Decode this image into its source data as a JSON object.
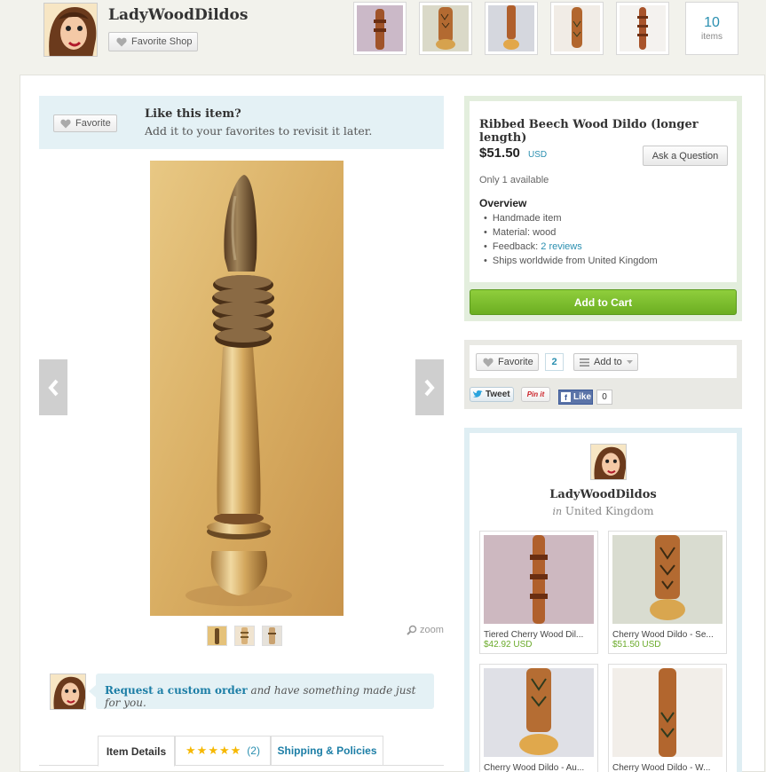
{
  "shop": {
    "name": "LadyWoodDildos",
    "favorite_shop_label": "Favorite Shop",
    "item_count": "10",
    "item_count_label": "items",
    "location_prefix": "in",
    "location": "United Kingdom"
  },
  "like_box": {
    "favorite_label": "Favorite",
    "title": "Like this item?",
    "subtitle": "Add it to your favorites to revisit it later."
  },
  "gallery": {
    "zoom_label": "zoom"
  },
  "custom_order": {
    "link": "Request a custom order",
    "rest": " and have something made just for you."
  },
  "tabs": {
    "details": "Item Details",
    "stars": "★★★★★",
    "review_count": "(2)",
    "shipping": "Shipping & Policies"
  },
  "item": {
    "title": "Ribbed Beech Wood Dildo (longer length)",
    "price": "$51.50",
    "currency": "USD",
    "ask_label": "Ask a Question",
    "availability": "Only 1 available",
    "overview_heading": "Overview",
    "overview": {
      "handmade": "Handmade item",
      "material": "Material: wood",
      "feedback_prefix": "Feedback: ",
      "feedback_link": "2 reviews",
      "ships": "Ships worldwide from United Kingdom"
    },
    "add_to_cart": "Add to Cart"
  },
  "social": {
    "favorite_label": "Favorite",
    "favorite_count": "2",
    "add_to_label": "Add to",
    "tweet_label": "Tweet",
    "pin_label": "Pin it",
    "like_label": "Like",
    "like_count": "0"
  },
  "shop_items": [
    {
      "title": "Tiered Cherry Wood Dil...",
      "price": "$42.92 USD"
    },
    {
      "title": "Cherry Wood Dildo - Se...",
      "price": "$51.50 USD"
    },
    {
      "title": "Cherry Wood Dildo - Au...",
      "price": ""
    },
    {
      "title": "Cherry Wood Dildo - W...",
      "price": ""
    }
  ],
  "colors": {
    "link": "#2a8fb0",
    "cart_green": "#7bbd2f",
    "price_green": "#6aaa2a",
    "info_blue_bg": "#e4f1f5"
  }
}
